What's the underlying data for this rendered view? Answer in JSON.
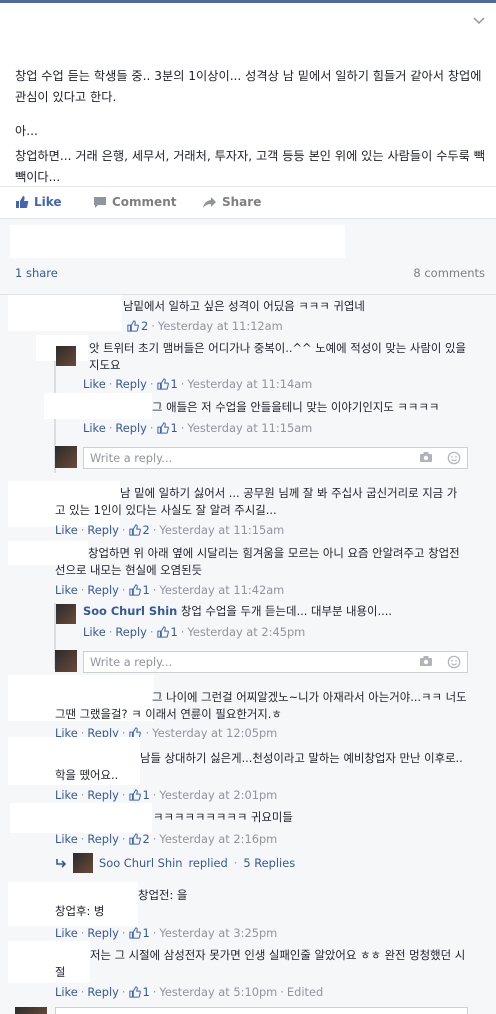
{
  "post": {
    "paragraph1": "창업 수업 듣는 학생들 중.. 3분의 1이상이... 성격상 남 밑에서 일하기 힘들거 같아서 창업에 관심이 있다고 한다.",
    "paragraph2": "아...",
    "paragraph3": "창업하면... 거래 은행, 세무서, 거래처, 투자자, 고객 등등 본인 위에 있는 사람들이 수두룩 빽빽이다..."
  },
  "actions": {
    "like": "Like",
    "comment": "Comment",
    "share": "Share"
  },
  "summary": {
    "shares": "1 share",
    "comments": "8 comments"
  },
  "labels": {
    "like": "Like",
    "reply": "Reply",
    "write_reply": "Write a reply...",
    "dot": "·"
  },
  "comments": [
    {
      "text": "남밑에서 일하고 싶은 성격이 어딨음 ㅋㅋㅋ 귀엽네",
      "likes": "2",
      "time": "Yesterday at 11:12am"
    },
    {
      "text": "앗 트위터 초기 맴버들은 어디가나 중복이..^^ 노예에 적성이 맞는 사람이 있을지도요",
      "likes": "1",
      "time": "Yesterday at 11:14am"
    },
    {
      "text": "그 애들은 저 수업을 안들을테니 맞는 이야기인지도 ㅋㅋㅋㅋ",
      "likes": "1",
      "time": "Yesterday at 11:15am"
    },
    {
      "text": "남 밑에 일하기 싫어서 ... 공무원 님께 잘 봐 주십사 굽신거리로 지금 가고 있는 1인이 있다는 사실도 잘 알려 주시길...",
      "likes": "2",
      "time": "Yesterday at 11:15am"
    },
    {
      "text": "창업하면 위 아래 옆에 시달리는 힘겨움을 모르는 아니 요즘 안알려주고 창업전선으로 내모는 현실에 오염된듯",
      "likes": "1",
      "time": "Yesterday at 11:42am"
    },
    {
      "author": "Soo Churl Shin",
      "text": "창업 수업을 두개 듣는데... 대부분 내용이....",
      "likes": "1",
      "time": "Yesterday at 2:45pm"
    },
    {
      "text": "그 나이에 그런걸 어찌알겠노~니가 아재라서 아는거야...ㅋㅋ 너도 그땐 그랬을걸? ㅋ 이래서 연륜이 필요한거지.ㅎ",
      "likes": "",
      "time": "Yesterday at 12:05pm"
    },
    {
      "text": "남들 상대하기 싫은게...천성이라고 말하는 예비창업자 만난 이후로..학을 뗐어요..",
      "likes": "1",
      "time": "Yesterday at 2:01pm"
    },
    {
      "text": "ㅋㅋㅋㅋㅋㅋㅋㅋㅋ 귀요미들",
      "likes": "2",
      "time": "Yesterday at 2:16pm"
    },
    {
      "text_line1": "창업전: 을",
      "text_line2": "창업후: 병",
      "likes": "1",
      "time": "Yesterday at 3:25pm"
    },
    {
      "text": "저는 그 시절에 삼성전자 못가면 인생 실패인줄 알았어요 ㅎㅎ 완전 멍청했던 시절",
      "likes": "1",
      "time": "Yesterday at 5:10pm",
      "edited": "Edited"
    }
  ],
  "replied": {
    "author": "Soo Churl Shin",
    "text": "replied",
    "count": "5 Replies"
  },
  "colors": {
    "link": "#365899",
    "like_active": "#4267b2",
    "meta": "#90949c",
    "feedback_bg": "#f6f7f9"
  }
}
